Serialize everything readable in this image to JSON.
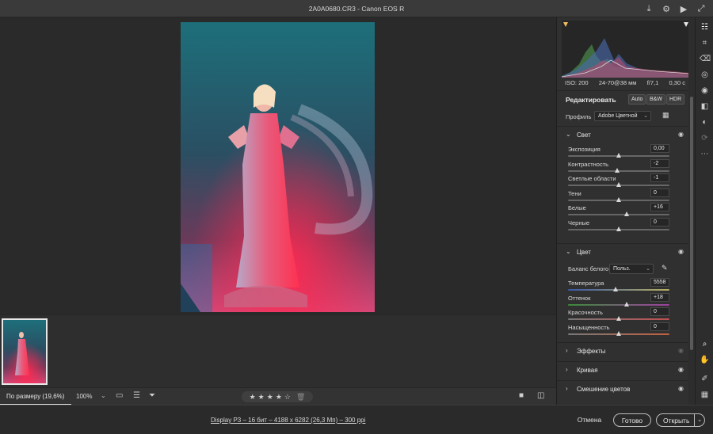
{
  "window": {
    "title": "2A0A0680.CR3  -  Canon EOS R"
  },
  "canvas": {
    "photo_alt": "photo"
  },
  "bottombar": {
    "fit_label": "По размеру (19,6%)",
    "zoom_label": "100%",
    "rating": "4 of 5 stars"
  },
  "statusbar": {
    "info": "Display P3 – 16 бит – 4188 x 6282 (26,3 Мп) – 300 ppi",
    "cancel": "Отмена",
    "done": "Готово",
    "open": "Открыть"
  },
  "panel": {
    "exif": {
      "iso": "ISO: 200",
      "lens": "24-70@38 мм",
      "aperture": "f/7,1",
      "shutter": "0,30 с"
    },
    "edit": {
      "title": "Редактировать",
      "auto": "Auto",
      "bw": "B&W",
      "hdr": "HDR",
      "profile_label": "Профиль",
      "profile_value": "Adobe Цветной"
    },
    "light": {
      "title": "Свет",
      "sliders": [
        {
          "label": "Экспозиция",
          "value": "0,00",
          "pos": 0.5
        },
        {
          "label": "Контрастность",
          "value": "-2",
          "pos": 0.49
        },
        {
          "label": "Светлые области",
          "value": "-1",
          "pos": 0.5
        },
        {
          "label": "Тени",
          "value": "0",
          "pos": 0.5
        },
        {
          "label": "Белые",
          "value": "+16",
          "pos": 0.58
        },
        {
          "label": "Черные",
          "value": "0",
          "pos": 0.5
        }
      ]
    },
    "color": {
      "title": "Цвет",
      "wb_label": "Баланс белого",
      "wb_value": "Польз.",
      "sliders": [
        {
          "label": "Температура",
          "value": "5558",
          "pos": 0.47
        },
        {
          "label": "Оттенок",
          "value": "+18",
          "pos": 0.58
        },
        {
          "label": "Красочность",
          "value": "0",
          "pos": 0.5
        },
        {
          "label": "Насыщенность",
          "value": "0",
          "pos": 0.5
        }
      ]
    },
    "sections": {
      "effects": "Эффекты",
      "curve": "Кривая",
      "mixer": "Смешение цветов"
    }
  },
  "colors": {
    "accent": "#e8e8e8",
    "panel_bg": "#303030",
    "canvas_bg": "#2a2a2a"
  }
}
